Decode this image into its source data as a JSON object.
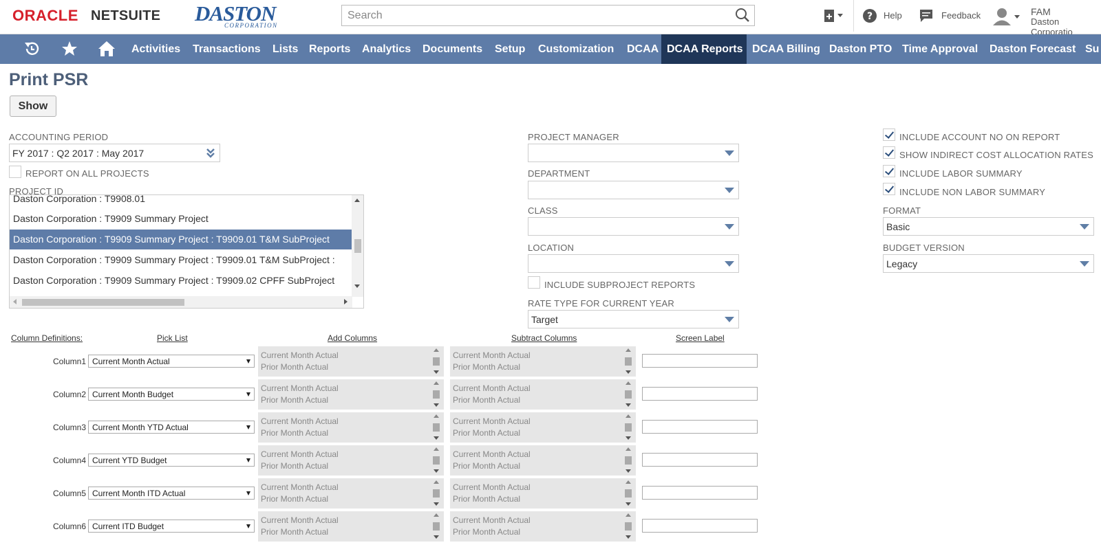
{
  "header": {
    "brand_oracle": "ORACLE",
    "brand_netsuite": "NETSUITE",
    "company_logo": "DASTON",
    "company_logo_sub": "CORPORATION",
    "search_placeholder": "Search",
    "help": "Help",
    "feedback": "Feedback",
    "user_initials": "FAM",
    "user_company": "Daston Corporatio"
  },
  "nav": {
    "icons": [
      "recent-icon",
      "star-icon",
      "home-icon"
    ],
    "items": [
      "Activities",
      "Transactions",
      "Lists",
      "Reports",
      "Analytics",
      "Documents",
      "Setup",
      "Customization",
      "DCAA",
      "DCAA Reports",
      "DCAA Billing",
      "Daston PTO",
      "Time Approval",
      "Daston Forecast",
      "Su"
    ],
    "active": "DCAA Reports"
  },
  "page": {
    "title": "Print PSR",
    "show_button": "Show"
  },
  "form": {
    "accounting_period_label": "ACCOUNTING PERIOD",
    "accounting_period_value": "FY 2017 : Q2 2017 : May 2017",
    "report_all_projects_label": "REPORT ON ALL PROJECTS",
    "project_id_label": "PROJECT ID",
    "project_list": [
      "Daston Corporation : T9908.01",
      "Daston Corporation : T9909 Summary Project",
      "Daston Corporation : T9909 Summary Project : T9909.01 T&M SubProject",
      "Daston Corporation : T9909 Summary Project : T9909.01 T&M SubProject :",
      "Daston Corporation : T9909 Summary Project : T9909.02 CPFF SubProject"
    ],
    "project_manager_label": "PROJECT MANAGER",
    "department_label": "DEPARTMENT",
    "class_label": "CLASS",
    "location_label": "LOCATION",
    "include_subproject_label": "INCLUDE SUBPROJECT REPORTS",
    "rate_type_label": "RATE TYPE FOR CURRENT YEAR",
    "rate_type_value": "Target",
    "include_account_no_label": "INCLUDE ACCOUNT NO ON REPORT",
    "show_indirect_label": "SHOW INDIRECT COST ALLOCATION RATES",
    "include_labor_label": "INCLUDE LABOR SUMMARY",
    "include_non_labor_label": "INCLUDE NON LABOR SUMMARY",
    "format_label": "FORMAT",
    "format_value": "Basic",
    "budget_version_label": "BUDGET VERSION",
    "budget_version_value": "Legacy"
  },
  "columns": {
    "headers": {
      "definitions": "Column Definitions:",
      "pick_list": "Pick List",
      "add_columns": "Add Columns",
      "subtract_columns": "Subtract Columns",
      "screen_label": "Screen Label"
    },
    "rows": [
      {
        "label": "Column1",
        "pick": "Current Month Actual",
        "opt1": "Current Month Actual",
        "opt2": "Prior Month Actual"
      },
      {
        "label": "Column2",
        "pick": "Current Month Budget",
        "opt1": "Current Month Actual",
        "opt2": "Prior Month Actual"
      },
      {
        "label": "Column3",
        "pick": "Current Month YTD Actual",
        "opt1": "Current Month Actual",
        "opt2": "Prior Month Actual"
      },
      {
        "label": "Column4",
        "pick": "Current YTD Budget",
        "opt1": "Current Month Actual",
        "opt2": "Prior Month Actual"
      },
      {
        "label": "Column5",
        "pick": "Current Month ITD Actual",
        "opt1": "Current Month Actual",
        "opt2": "Prior Month Actual"
      },
      {
        "label": "Column6",
        "pick": "Current ITD Budget",
        "opt1": "Current Month Actual",
        "opt2": "Prior Month Actual"
      }
    ]
  },
  "colors": {
    "nav_bg": "#5e7ca8",
    "nav_active": "#1f3658",
    "title": "#4d5f79",
    "oracle_red": "#d6202b"
  }
}
